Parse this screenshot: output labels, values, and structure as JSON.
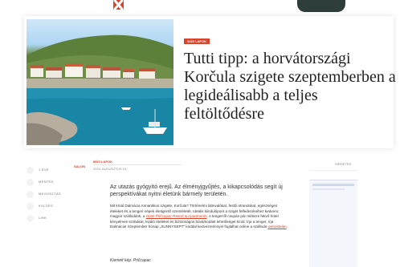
{
  "header": {
    "logo_text": "",
    "cta_label": ""
  },
  "article": {
    "category_badge": "MÁS LAPOK",
    "title": "Tutti tipp: a horvátországi Korčula szigete szeptemberben a legideálisabb a teljes feltöltődésre",
    "section": "SALON",
    "author": "MÁS LAPOK",
    "date": "2024. AUGUSZTUS 15.",
    "lead": "Az utazás gyógyító erejű. Az élményjgyűjtés, a kikapcsolódás segít új perspektívákat nyitni életünk bármely területén.",
    "body_part1": "Mit kínál Dalmácia romantikus szigete, Korčula? Történelmi látnivalókat, festői strandokat, egészséges ételeket és a tengeri népek életigenlő szemléletét. Ideális kiindulópont a sziget felfedezéséhez kedvenc magyar szállodánk, a ",
    "body_link": "Hotel Pričcapac Resort & Apartments",
    "body_part2": ". A tengerről csupán pár méterre fekvő hotel kényelmes szobákat, kiváló ételeket és biztonságos búvárkodást lehetőséget kínál. Írja a tenger, írja Dalmácia! Szeptember hónap „SUNNYSEPT\" kóddal kedvezménnyel foglalhat online a szálloda ",
    "body_link2": "weboldalán",
    "body_end": ".",
    "credit_prefix": "Kiemelt kép: Pričcapac"
  },
  "share": [
    {
      "label": "1 ÉVE"
    },
    {
      "label": "MENTÉS"
    },
    {
      "label": "MEGOSZTÁS"
    },
    {
      "label": "KÜLDÉS"
    },
    {
      "label": "LINK"
    }
  ],
  "sidebar": {
    "ad_label": "HIRDETÉS"
  },
  "colors": {
    "accent": "#d8452b",
    "dark_button": "#2d3d3a"
  }
}
